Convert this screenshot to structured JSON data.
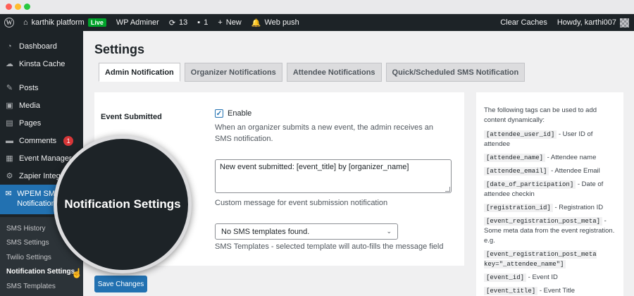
{
  "admin_bar": {
    "site_name": "karthik platform",
    "live_badge": "Live",
    "wp_adminer": "WP Adminer",
    "updates_count": "13",
    "comments_count": "1",
    "new_label": "New",
    "web_push": "Web push",
    "clear_caches": "Clear Caches",
    "howdy": "Howdy, karthi007"
  },
  "sidebar": {
    "items": [
      {
        "label": "Dashboard",
        "icon": "dashboard-icon"
      },
      {
        "label": "Kinsta Cache",
        "icon": "cloud-icon"
      },
      {
        "label": "Posts",
        "icon": "pin-icon"
      },
      {
        "label": "Media",
        "icon": "media-icon"
      },
      {
        "label": "Pages",
        "icon": "page-icon"
      },
      {
        "label": "Comments",
        "icon": "comment-icon",
        "badge": "1"
      },
      {
        "label": "Event Manager",
        "icon": "calendar-icon"
      },
      {
        "label": "Zapier Integr",
        "icon": "gear-icon"
      },
      {
        "label": "WPEM SMS Notification",
        "icon": "email-icon"
      }
    ],
    "submenu": [
      {
        "label": "SMS History"
      },
      {
        "label": "SMS Settings"
      },
      {
        "label": "Twilio Settings"
      },
      {
        "label": "Notification Settings"
      },
      {
        "label": "SMS Templates"
      }
    ]
  },
  "page": {
    "title": "Settings",
    "tabs": [
      {
        "label": "Admin Notification"
      },
      {
        "label": "Organizer Notifications"
      },
      {
        "label": "Attendee Notifications"
      },
      {
        "label": "Quick/Scheduled SMS Notification"
      }
    ]
  },
  "form": {
    "field_label": "Event Submitted",
    "enable_label": "Enable",
    "enable_desc": "When an organizer submits a new event, the admin receives an SMS notification.",
    "message_value": "New event submitted: [event_title] by [organizer_name]",
    "message_desc": "Custom message for event submission notification",
    "template_value": "No SMS templates found.",
    "template_desc": "SMS Templates - selected template will auto-fills the message field",
    "save_label": "Save Changes"
  },
  "tags_panel": {
    "intro": "The following tags can be used to add content dynamically:",
    "tags": [
      {
        "code": "[attendee_user_id]",
        "desc": "- User ID of attendee"
      },
      {
        "code": "[attendee_name]",
        "desc": "- Attendee name"
      },
      {
        "code": "[attendee_email]",
        "desc": "- Attendee Email"
      },
      {
        "code": "[date_of_participation]",
        "desc": "- Date of attendee checkin"
      },
      {
        "code": "[registration_id]",
        "desc": "- Registration ID"
      },
      {
        "code": "[event_registration_post_meta]",
        "desc": "- Some meta data from the event registration. e.g."
      },
      {
        "code": "[event_registration_post_meta key=\"_attendee_name\"]",
        "desc": ""
      },
      {
        "code": "[event_id]",
        "desc": "- Event ID"
      },
      {
        "code": "[event_title]",
        "desc": "- Event Title"
      }
    ]
  },
  "magnifier_label": "Notification Settings",
  "colors": {
    "admin_bar": "#1d2327",
    "accent": "#2271b1",
    "live": "#00a32a",
    "badge": "#d63638"
  }
}
